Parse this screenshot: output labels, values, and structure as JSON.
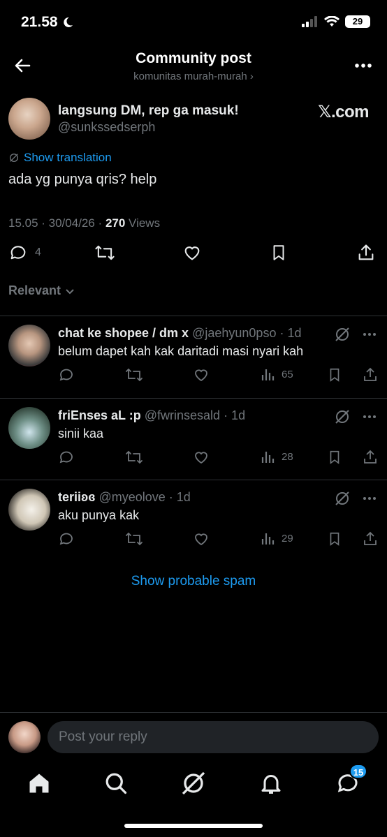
{
  "status_bar": {
    "time": "21.58",
    "battery": "29"
  },
  "header": {
    "title": "Community post",
    "subtitle": "komunitas murah-murah ›"
  },
  "post": {
    "author_name": "langsung DM, rep ga masuk!",
    "author_handle": "@sunkssedserph",
    "source_badge": "𝕏.com",
    "show_translation": "Show translation",
    "text": "ada yg punya qris? help",
    "timestamp": "15.05 · 30/04/26 · ",
    "views_count": "270",
    "views_label": " Views",
    "reply_count": "4"
  },
  "sort": {
    "label": "Relevant"
  },
  "replies": [
    {
      "name": "chat ke shopee / dm x",
      "handle": "@jaehyun0pso",
      "time": "· 1d",
      "text": "belum dapet kah kak daritadi masi nyari kah",
      "views": "65"
    },
    {
      "name": "friEnses aL :p",
      "handle": "@fwrinsesald",
      "time": "· 1d",
      "text": "sinii kaa",
      "views": "28"
    },
    {
      "name": "teriiʚɞ",
      "handle": "@myeolove",
      "time": "· 1d",
      "text": "aku punya kak",
      "views": "29"
    }
  ],
  "spam_link": "Show probable spam",
  "compose": {
    "placeholder": "Post your reply"
  },
  "nav": {
    "messages_badge": "15"
  },
  "colors": {
    "accent": "#1d9bf0",
    "background": "#000000",
    "muted": "#71767b",
    "divider": "#2f3336"
  },
  "icons": [
    "back-arrow-icon",
    "more-icon",
    "reply-icon",
    "repost-icon",
    "like-icon",
    "bookmark-icon",
    "share-icon",
    "views-icon",
    "grok-icon",
    "home-icon",
    "search-icon",
    "notifications-icon",
    "messages-icon"
  ]
}
